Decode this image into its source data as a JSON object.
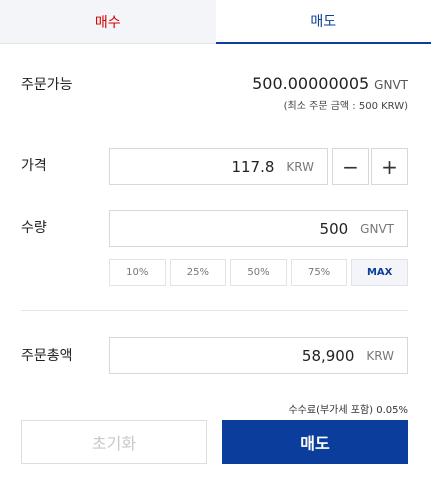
{
  "tabs": {
    "buy": "매수",
    "sell": "매도"
  },
  "available": {
    "label": "주문가능",
    "value": "500.00000005",
    "unit": "GNVT",
    "min_order": "(최소 주문 금액 : 500  KRW)"
  },
  "price": {
    "label": "가격",
    "value": "117.8",
    "unit": "KRW",
    "minus": "−",
    "plus": "+"
  },
  "quantity": {
    "label": "수량",
    "value": "500",
    "unit": "GNVT",
    "percents": [
      "10%",
      "25%",
      "50%",
      "75%"
    ],
    "max": "MAX"
  },
  "total": {
    "label": "주문총액",
    "value": "58,900",
    "unit": "KRW"
  },
  "fee": "수수료(부가세 포함) 0.05%",
  "actions": {
    "reset": "초기화",
    "sell": "매도"
  },
  "colors": {
    "buy": "#d60000",
    "sell": "#0b3e9c"
  }
}
